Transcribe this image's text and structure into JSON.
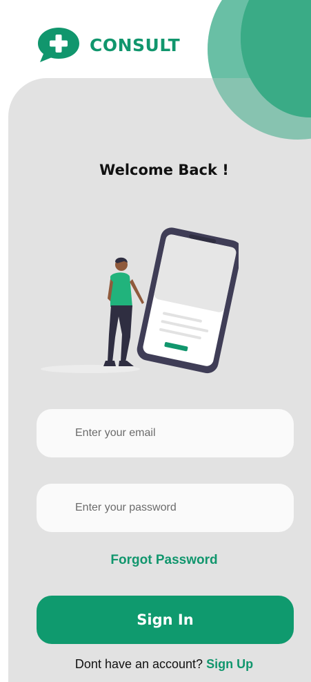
{
  "brand": {
    "name": "CONSULT",
    "icon": "chat-plus-icon",
    "color": "#11966d"
  },
  "login": {
    "title": "Welcome Back !",
    "email_placeholder": "Enter your email",
    "password_placeholder": "Enter your password",
    "forgot_label": "Forgot Password",
    "signin_label": "Sign In",
    "signup_prompt": "Dont have an account?",
    "signup_link": "Sign Up"
  },
  "colors": {
    "primary": "#0f9a6e",
    "card_background": "#e2e2e2",
    "accent_light": "#8fd3bf"
  }
}
